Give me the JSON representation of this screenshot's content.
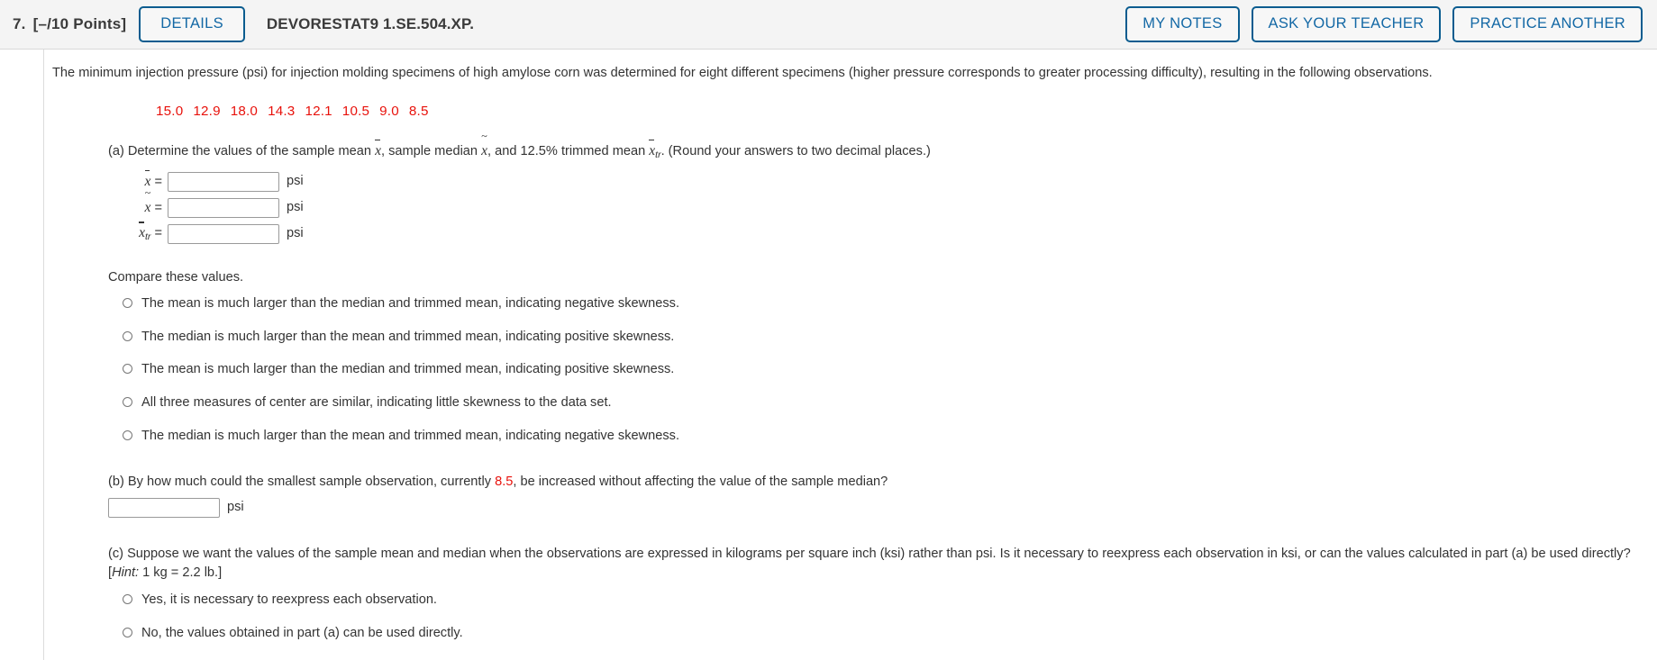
{
  "header": {
    "question_number": "7.",
    "points": "[–/10 Points]",
    "details_label": "DETAILS",
    "question_code": "DEVORESTAT9 1.SE.504.XP.",
    "my_notes_label": "MY NOTES",
    "ask_teacher_label": "ASK YOUR TEACHER",
    "practice_another_label": "PRACTICE ANOTHER",
    "accent_color": "#0a5c8f",
    "link_color": "#1368a5",
    "bar_background": "#f4f4f4"
  },
  "question": {
    "intro": "The minimum injection pressure (psi) for injection molding specimens of high amylose corn was determined for eight different specimens (higher pressure corresponds to greater processing difficulty), resulting in the following observations.",
    "data_color": "#e8120c",
    "observations": [
      "15.0",
      "12.9",
      "18.0",
      "14.3",
      "12.1",
      "10.5",
      "9.0",
      "8.5"
    ]
  },
  "part_a": {
    "prompt_1": "(a) Determine the values of the sample mean ",
    "prompt_2": ", sample median ",
    "prompt_3": ", and 12.5% trimmed mean ",
    "prompt_4": ". (Round your answers to two decimal places.)",
    "var_mean": "x",
    "var_median": "x",
    "var_trimmed": "x",
    "var_trimmed_sub": "tr",
    "equals": "=",
    "unit": "psi",
    "field_mean_value": "",
    "field_median_value": "",
    "field_trimmed_value": "",
    "compare_label": "Compare these values.",
    "options": [
      "The mean is much larger than the median and trimmed mean, indicating negative skewness.",
      "The median is much larger than the mean and trimmed mean, indicating positive skewness.",
      "The mean is much larger than the median and trimmed mean, indicating positive skewness.",
      "All three measures of center are similar, indicating little skewness to the data set.",
      "The median is much larger than the mean and trimmed mean, indicating negative skewness."
    ]
  },
  "part_b": {
    "prompt_1": "(b) By how much could the smallest sample observation, currently ",
    "value": "8.5",
    "prompt_2": ", be increased without affecting the value of the sample median?",
    "field_value": "",
    "unit": "psi"
  },
  "part_c": {
    "prompt_1": "(c) Suppose we want the values of the sample mean and median when the observations are expressed in kilograms per square inch (ksi) rather than psi. Is it necessary to reexpress each observation in ksi, or can the values calculated in part (a) be used directly? [",
    "hint_label": "Hint:",
    "prompt_2": " 1 kg = 2.2 lb.]",
    "options": [
      "Yes, it is necessary to reexpress each observation.",
      "No, the values obtained in part (a) can be used directly."
    ]
  }
}
